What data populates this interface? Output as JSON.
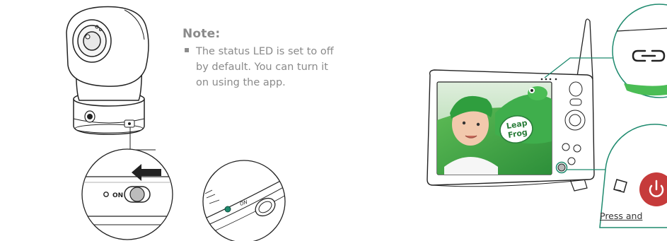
{
  "note": {
    "title": "Note:",
    "bullet": "▪",
    "text": "The status LED is set to off by default. You can turn it on using the app."
  },
  "switch_label": "ON",
  "switch_label_closeup": "ON",
  "monitor_logo": [
    "Leap",
    "Frog"
  ],
  "press_label": "Press and",
  "colors": {
    "accent_green": "#1e8a6e",
    "power_red": "#c63b3b",
    "note_gray": "#8a8a8a",
    "screen_green": "#3fae4c"
  }
}
